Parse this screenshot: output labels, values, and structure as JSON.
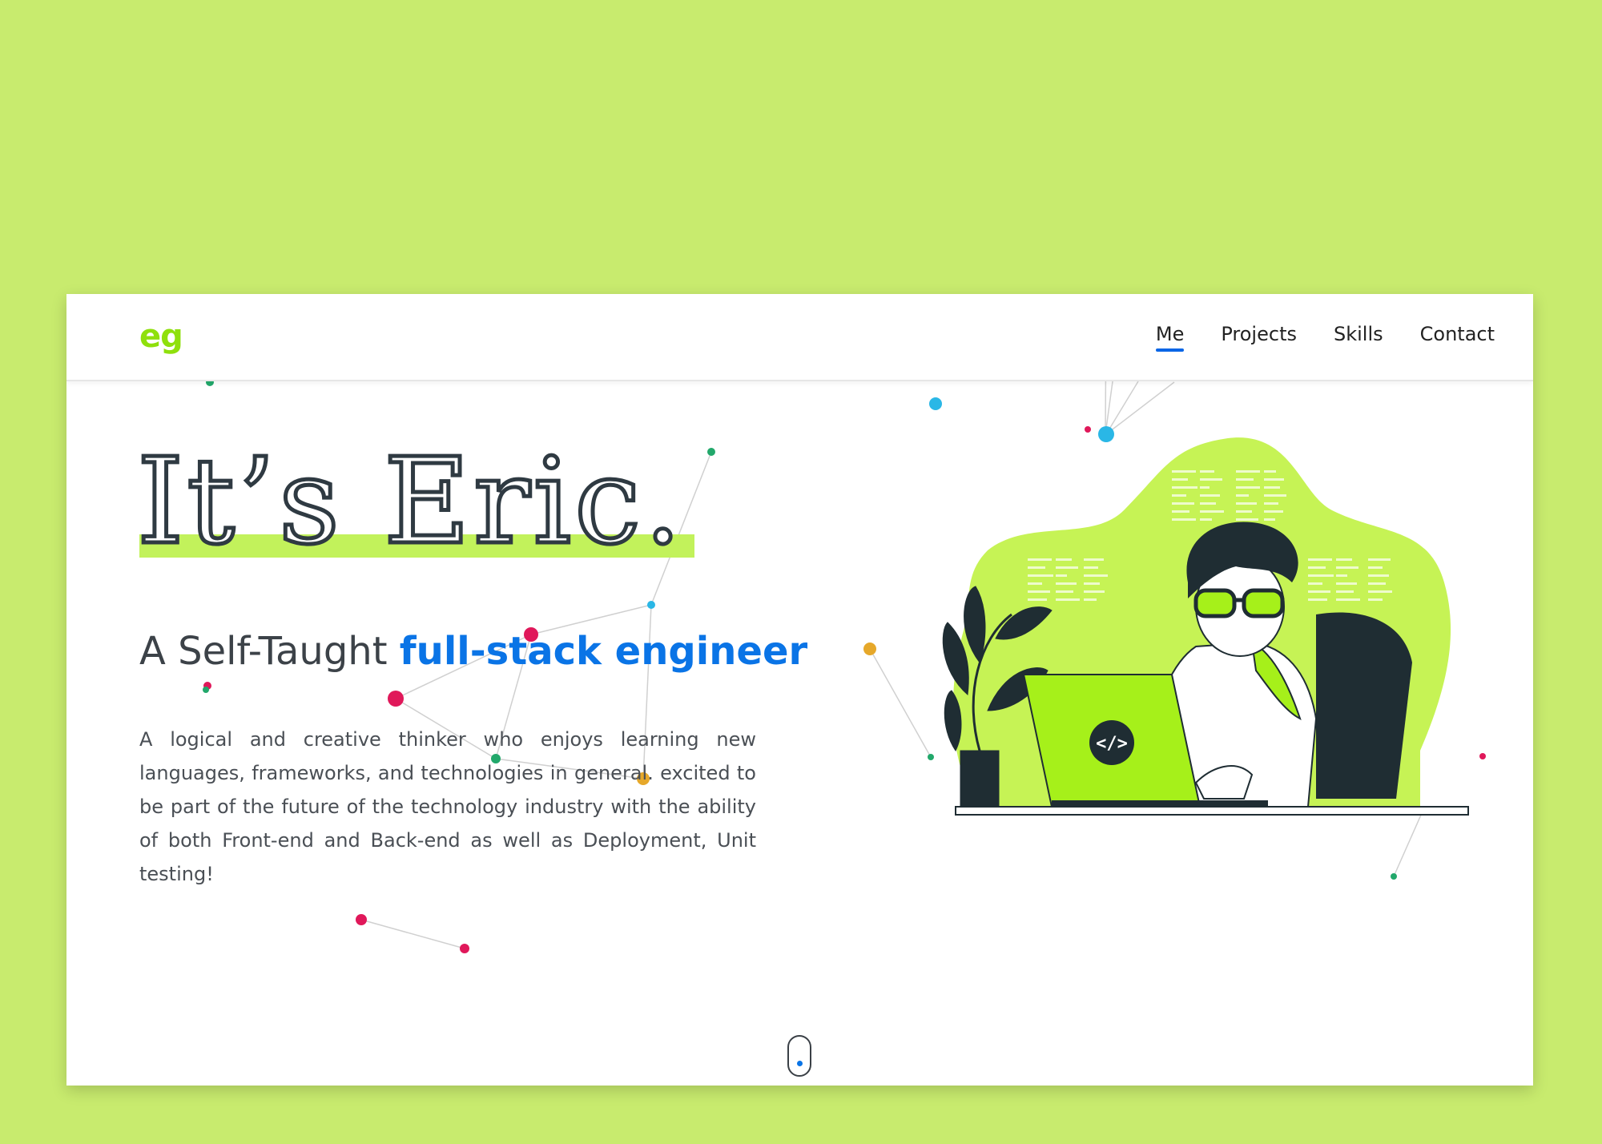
{
  "header": {
    "logo": "eg",
    "nav": [
      {
        "label": "Me",
        "active": true
      },
      {
        "label": "Projects",
        "active": false
      },
      {
        "label": "Skills",
        "active": false
      },
      {
        "label": "Contact",
        "active": false
      }
    ]
  },
  "hero": {
    "title": "It’s Eric.",
    "subtitle_prefix": "A Self-Taught ",
    "subtitle_accent": "full-stack engineer",
    "bio": "A logical and creative thinker who enjoys learning new languages, frameworks, and technologies in general. excited to be part of the future of the technology industry with the ability of both Front-end and Back-end as well as Deployment, Unit testing!"
  },
  "illustration": {
    "laptop_code_symbol": "</>"
  },
  "colors": {
    "background": "#c8eb6e",
    "accent_green": "#a6f01a",
    "accent_blue": "#0a74e6",
    "dark": "#2f3a42"
  }
}
